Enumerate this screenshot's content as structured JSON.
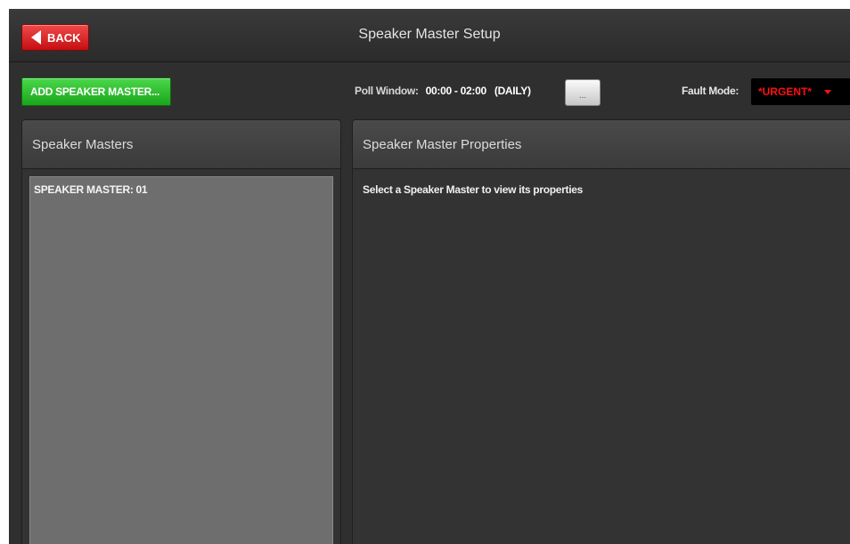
{
  "window": {
    "title": "Speaker Master Setup"
  },
  "header": {
    "back_label": "BACK"
  },
  "toolbar": {
    "add_label": "ADD SPEAKER MASTER...",
    "poll_window_label": "Poll Window:",
    "poll_window_value": "00:00 - 02:00",
    "poll_window_frequency": "(DAILY)",
    "edit_button_label": "...",
    "fault_mode_label": "Fault Mode:",
    "fault_mode_value": "*URGENT*"
  },
  "speaker_masters": {
    "title": "Speaker Masters",
    "items": [
      {
        "label": "SPEAKER MASTER: 01"
      }
    ]
  },
  "properties": {
    "title": "Speaker Master Properties",
    "placeholder": "Select a Speaker Master to view its properties"
  },
  "colors": {
    "back_button": "#d7191c",
    "add_button": "#2cc02c",
    "fault_mode_text": "#ff1010",
    "panel_bg": "#333333",
    "list_bg": "#6e6e6e"
  }
}
